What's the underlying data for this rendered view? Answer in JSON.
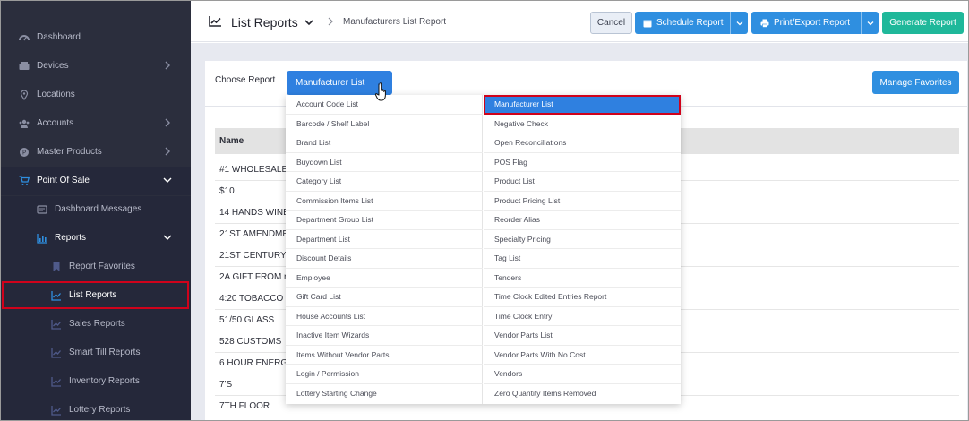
{
  "sidebar": {
    "items": [
      {
        "label": "Dashboard",
        "icon": "dashboard-icon"
      },
      {
        "label": "Devices",
        "icon": "devices-icon"
      },
      {
        "label": "Locations",
        "icon": "location-pin-icon"
      },
      {
        "label": "Accounts",
        "icon": "users-icon"
      },
      {
        "label": "Master Products",
        "icon": "product-icon"
      },
      {
        "label": "Point Of Sale",
        "icon": "cart-icon"
      },
      {
        "label": "Dashboard Messages",
        "icon": "message-icon"
      },
      {
        "label": "Reports",
        "icon": "chart-icon"
      },
      {
        "label": "Report Favorites",
        "icon": "bookmark-icon"
      },
      {
        "label": "List Reports",
        "icon": "line-chart-icon"
      },
      {
        "label": "Sales Reports",
        "icon": "line-chart-icon"
      },
      {
        "label": "Smart Till Reports",
        "icon": "line-chart-icon"
      },
      {
        "label": "Inventory Reports",
        "icon": "line-chart-icon"
      },
      {
        "label": "Lottery Reports",
        "icon": "line-chart-icon"
      }
    ]
  },
  "header": {
    "title": "List Reports",
    "breadcrumb": "Manufacturers List Report",
    "cancel_label": "Cancel",
    "schedule_label": "Schedule Report",
    "print_label": "Print/Export Report",
    "generate_label": "Generate Report"
  },
  "panel": {
    "choose_label": "Choose Report",
    "report_button_label": "Manufacturer List",
    "favorites_label": "Manage Favorites",
    "table_header": "Name",
    "rows": [
      "#1 WHOLESALE",
      "$10",
      "14 HANDS WINE",
      "21ST AMENDME",
      "21ST CENTURY",
      "2A GIFT FROM r",
      "4:20 TOBACCO",
      "51/50 GLASS",
      "528 CUSTOMS",
      "6 HOUR ENERG",
      "7'S",
      "7TH FLOOR"
    ]
  },
  "dropdown": {
    "left": [
      "Account Code List",
      "Barcode / Shelf Label",
      "Brand List",
      "Buydown List",
      "Category List",
      "Commission Items List",
      "Department Group List",
      "Department List",
      "Discount Details",
      "Employee",
      "Gift Card List",
      "House Accounts List",
      "Inactive Item Wizards",
      "Items Without Vendor Parts",
      "Login / Permission",
      "Lottery Starting Change"
    ],
    "right": [
      "Manufacturer List",
      "Negative Check",
      "Open Reconciliations",
      "POS Flag",
      "Product List",
      "Product Pricing List",
      "Reorder Alias",
      "Specialty Pricing",
      "Tag List",
      "Tenders",
      "Time Clock Edited Entries Report",
      "Time Clock Entry",
      "Vendor Parts List",
      "Vendor Parts With No Cost",
      "Vendors",
      "Zero Quantity Items Removed"
    ]
  },
  "colors": {
    "sidebar_bg": "#2b2e3d",
    "primary_blue": "#2f8fe0",
    "generate_green": "#1fb89a",
    "highlight_red": "#d0021b"
  }
}
